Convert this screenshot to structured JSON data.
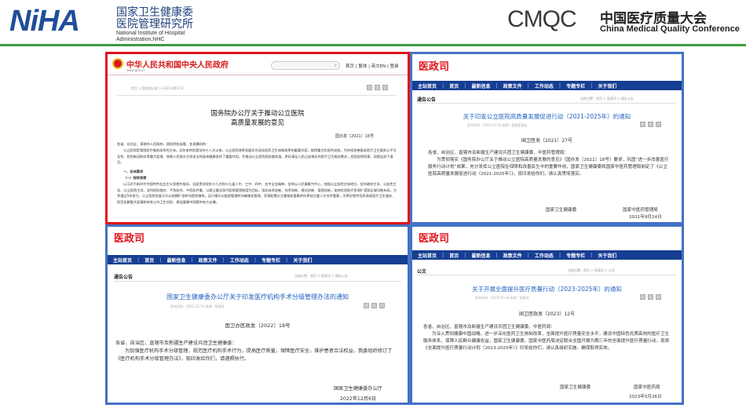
{
  "header": {
    "niha_logo": "NiHA",
    "niha_cn": "国家卫生健康委医院管理研究所",
    "niha_en_1": "National Institute of Hospital",
    "niha_en_2": "Administration,NHC",
    "cmqc_logo": "CMQC",
    "cmqc_cn": "中国医疗质量大会",
    "cmqc_en": "China Medical Quality Conference",
    "accent_green": "#3b9b3b",
    "accent_blue": "#1f4e9a"
  },
  "colors": {
    "red_frame": "#e0141c",
    "blue_frame": "#4472c4",
    "nav_bg": "#163e93",
    "title_blue": "#1f5fbf"
  },
  "gov_panel": {
    "site_title": "中华人民共和国中央人民政府",
    "site_url": "www.gov.cn",
    "links": "首页 | 繁体 | 英文EN | 登录",
    "crumb": "首页 > 国务院公报 > 2021年第17号",
    "doc_title_1": "国务院办公厅关于推动公立医院",
    "doc_title_2": "高质量发展的意见",
    "doc_no": "国办发〔2021〕18号",
    "addressee": "各省、自治区、直辖市人民政府，国务院各部委、各直属机构：",
    "para1": "公立医院是我国医疗服务体系的主体。近年来特别是党的十八大以来，公立医院改革发展作为深化医药卫生体制改革的重要内容，取得重大阶段性成效，为持续改善基本医疗卫生服务公平可及性、防控新冠肺炎等重大疫情、保障人民群众生命安全和身体健康发挥了重要作用。为推动公立医院高质量发展，更好满足人民日益增长的医疗卫生服务需求，经国务院同意，现提出如下意见。",
    "section": "一、总体要求",
    "sub_section": "（一）指导思想",
    "para2": "以习近平新时代中国特色社会主义思想为指导，全面贯彻党的十九大和十九届二中、三中、四中、五中全会精神，坚持以人民健康为中心，加强公立医院主体地位，坚持政府主导、公益性主导、公立医院主导，坚持医防融合、平急结合、中西医并重，以建立健全现代医院管理制度为目标，强化体系创新、技术创新、模式创新、管理创新，加快优质医疗资源扩容和区域均衡布局，力争通过5年努力，公立医院发展方式从规模扩张转向提质增效，运行模式从粗放管理转向精细化管理，资源配置从注重物质要素转向更加注重人才技术要素，为更好提供优质高效医疗卫生服务、防范化解重大疫情和突发公共卫生风险、建设健康中国提供有力支撑。"
  },
  "panel_2021": {
    "bureau": "医政司",
    "nav": [
      "主站首页",
      "首页",
      "最新信息",
      "政策文件",
      "工作动态",
      "专题专栏",
      "关于我们"
    ],
    "section": "通告公告",
    "crumb": "当前位置：首页 > 医政司 > 通告公告",
    "title": "关于印发公立医院高质量发展促进行动（2021-2025年）的通知",
    "meta": "发布时间：2021-10-14  来源：医政医管局",
    "doc_no": "国卫医发〔2021〕27号",
    "addressee": "各省、自治区、直辖市及新疆生产建设兵团卫生健康委、中医药管理局：",
    "body": "为贯彻落实《国务院办公厅关于推动公立医院高质量发展的意见》（国办发〔2021〕18号）要求，巩固“进一步改善医疗服务行动计划”成果，充分发挥公立医院在保障和改善民生中的重要作用，国家卫生健康委和国家中医药管理局制定了《公立医院高质量发展促进行动（2021-2025年）》，现印发给你们，请认真贯彻落实。",
    "sign_1": "国家卫生健康委",
    "sign_2": "国家中医药管理局",
    "date": "2021年9月14日"
  },
  "panel_2022": {
    "bureau": "医政司",
    "nav": [
      "主站首页",
      "首页",
      "最新信息",
      "政策文件",
      "工作动态",
      "专题专栏",
      "关于我们"
    ],
    "section": "通告公告",
    "crumb": "当前位置：首页 > 医政司 > 通告公告",
    "title": "国家卫生健康委办公厅关于印发医疗机构手术分级管理办法的通知",
    "meta": "发布时间：2022-12-19  来源：医政司",
    "doc_no": "国卫办医政发〔2022〕18号",
    "addressee": "各省、自治区、直辖市及新疆生产建设兵团卫生健康委：",
    "body": "为加强医疗机构手术分级管理，规范医疗机构手术行为，提高医疗质量，保障医疗安全，维护患者合法权益，我委组织修订了《医疗机构手术分级管理办法》，现印发给你们，请遵照执行。",
    "sign": "国家卫生健康委办公厅",
    "date": "2022年12月6日"
  },
  "panel_2023": {
    "bureau": "医政司",
    "nav": [
      "主站首页",
      "首页",
      "最新信息",
      "政策文件",
      "工作动态",
      "专题专栏",
      "关于我们"
    ],
    "section": "公文",
    "crumb": "当前位置：首页 > 医政司 > 公文",
    "title": "关于开展全面提升医疗质量行动（2023-2025年）的通知",
    "meta": "发布时间：2023-05-29  来源：医政司",
    "doc_no": "国卫医政发〔2023〕12号",
    "addressee": "各省、自治区、直辖市及新疆生产建设兵团卫生健康委、中医药局：",
    "body": "为深入贯彻健康中国战略，进一步深化医药卫生体制改革，全面提升医疗质量安全水平，建设中国特色优质高效的医疗卫生服务体系，保障人民群众健康权益，国家卫生健康委、国家中医药局决定联合全国开展为期三年的全面提升医疗质量行动，现将《全面提升医疗质量行动计划（2023-2025年）》印发给你们，请认真组织实施，确保取得实效。",
    "sign_1": "国家卫生健康委",
    "sign_2": "国家中医药局",
    "date": "2023年5月26日"
  }
}
